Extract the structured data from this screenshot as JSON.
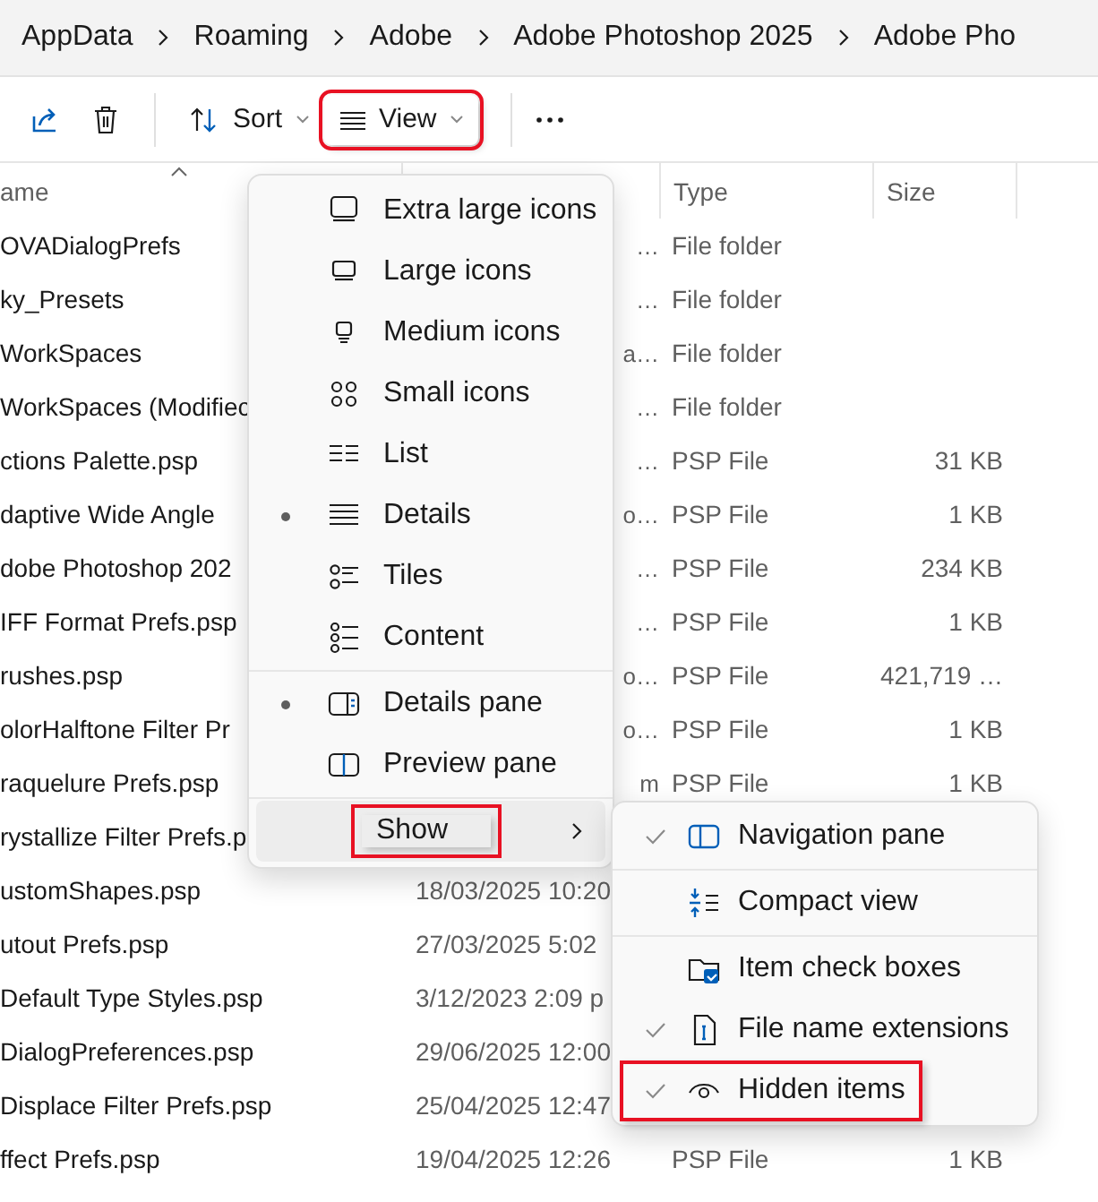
{
  "breadcrumb": [
    {
      "label": "AppData"
    },
    {
      "label": "Roaming"
    },
    {
      "label": "Adobe"
    },
    {
      "label": "Adobe Photoshop 2025"
    },
    {
      "label": "Adobe Pho"
    }
  ],
  "toolbar": [
    {
      "kind": "share"
    },
    {
      "kind": "delete"
    },
    {
      "kind": "divider"
    },
    {
      "kind": "sort",
      "label": "Sort"
    },
    {
      "kind": "view",
      "label": "View",
      "highlighted": true
    },
    {
      "kind": "divider"
    },
    {
      "kind": "more"
    }
  ],
  "columns": [
    {
      "kind": "name",
      "label": "ame",
      "sorted": true
    },
    {
      "kind": "type",
      "label": "Type"
    },
    {
      "kind": "size",
      "label": "Size"
    }
  ],
  "rows": [
    {
      "name": "OVADialogPrefs",
      "date_tail": "…",
      "type": "File folder"
    },
    {
      "name": "ky_Presets",
      "date_tail": "…",
      "type": "File folder"
    },
    {
      "name": "WorkSpaces",
      "date_tail": "a…",
      "type": "File folder"
    },
    {
      "name": "WorkSpaces (Modifiec",
      "date_tail": "…",
      "type": "File folder"
    },
    {
      "name": "ctions Palette.psp",
      "date_tail": "…",
      "type": "PSP File",
      "size": "31 KB"
    },
    {
      "name": "daptive Wide Angle",
      "date_tail": "o…",
      "type": "PSP File",
      "size": "1 KB"
    },
    {
      "name": "dobe Photoshop 202",
      "date_tail": "…",
      "type": "PSP File",
      "size": "234 KB"
    },
    {
      "name": "IFF Format Prefs.psp",
      "date_tail": "…",
      "type": "PSP File",
      "size": "1 KB"
    },
    {
      "name": "rushes.psp",
      "date_tail": "o…",
      "type": "PSP File",
      "size": "421,719 …"
    },
    {
      "name": "olorHalftone Filter Pr",
      "date_tail": "o…",
      "type": "PSP File",
      "size": "1 KB"
    },
    {
      "name": "raquelure Prefs.psp",
      "date_tail": "m",
      "type": "PSP File",
      "size": "1 KB"
    },
    {
      "name": "rystallize Filter Prefs.p"
    },
    {
      "name": "ustomShapes.psp",
      "date": "18/03/2025 10:20"
    },
    {
      "name": "utout Prefs.psp",
      "date": "27/03/2025 5:02"
    },
    {
      "name": "Default Type Styles.psp",
      "date": "3/12/2023 2:09 p"
    },
    {
      "name": "DialogPreferences.psp",
      "date": "29/06/2025 12:00"
    },
    {
      "name": "Displace Filter Prefs.psp",
      "date": "25/04/2025 12:47"
    },
    {
      "name": "ffect Prefs.psp",
      "date": "19/04/2025 12:26",
      "type": "PSP File",
      "size": "1 KB"
    }
  ],
  "view_menu": {
    "groups": [
      [
        {
          "label": "Extra large icons",
          "selected": false
        },
        {
          "label": "Large icons",
          "selected": false
        },
        {
          "label": "Medium icons",
          "selected": false
        },
        {
          "label": "Small icons",
          "selected": false
        },
        {
          "label": "List",
          "selected": false
        },
        {
          "label": "Details",
          "selected": true
        },
        {
          "label": "Tiles",
          "selected": false
        },
        {
          "label": "Content",
          "selected": false
        }
      ],
      [
        {
          "label": "Details pane",
          "selected": true
        },
        {
          "label": "Preview pane",
          "selected": false
        }
      ],
      [
        {
          "label": "Show",
          "has_submenu": true,
          "hovered": true,
          "highlighted": true
        }
      ]
    ]
  },
  "show_submenu": {
    "groups": [
      [
        {
          "label": "Navigation pane",
          "checked": true,
          "highlighted": false
        }
      ],
      [
        {
          "label": "Compact view",
          "checked": false,
          "highlighted": false
        }
      ],
      [
        {
          "label": "Item check boxes",
          "checked": false,
          "highlighted": false
        },
        {
          "label": "File name extensions",
          "checked": true,
          "highlighted": false
        },
        {
          "label": "Hidden items",
          "checked": true,
          "highlighted": true
        }
      ]
    ]
  }
}
